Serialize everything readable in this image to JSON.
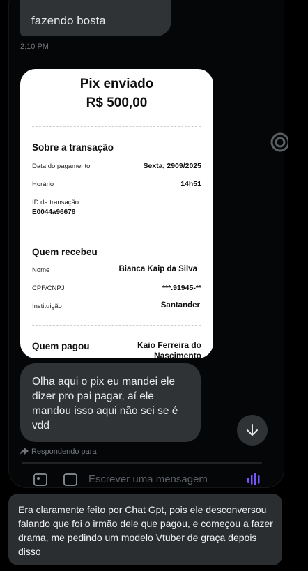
{
  "chat": {
    "top_message": "fazendo bosta",
    "timestamp": "2:10 PM",
    "message": "Olha aqui o pix eu mandei ele dizer pro pai pagar, aí ele mandou isso aqui não sei se é vdd",
    "replying_to": "Respondendo para",
    "composer_placeholder": "Escrever uma mensagem"
  },
  "receipt": {
    "title": "Pix enviado",
    "amount": "R$ 500,00",
    "about_heading": "Sobre a transação",
    "payment_date_label": "Data do pagamento",
    "payment_date": "Sexta, 2909/2025",
    "time_label": "Horário",
    "time": "14h51",
    "transaction_id_label": "ID da transação",
    "transaction_id": "E0044a96678",
    "receiver_heading": "Quem recebeu",
    "name_label": "Nome",
    "name": "Bianca Kaip da Silva",
    "cpf_label": "CPF/CNPJ",
    "cpf": "***.91945-**",
    "institution_label": "Instituição",
    "institution": "Santander",
    "payer_heading": "Quem pagou",
    "payer_name": "Kaio Ferreira do Nascimento"
  },
  "caption": "Era claramente feito por Chat Gpt, pois ele desconversou falando que foi o irmão dele que pagou, e começou a fazer drama, me pedindo um modelo Vtuber de graça depois disso",
  "icons": [
    "reply-arrow-icon",
    "arrow-down-icon",
    "image-icon",
    "gif-icon",
    "voice-wave-icon",
    "target-ring-icon"
  ]
}
